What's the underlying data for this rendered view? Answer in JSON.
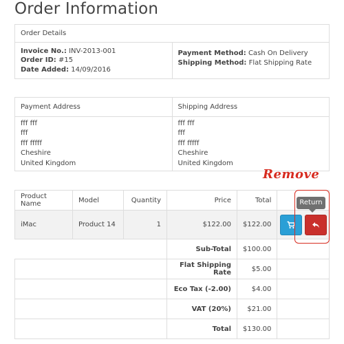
{
  "page_title": "Order Information",
  "order_details": {
    "header": "Order Details",
    "invoice_label": "Invoice No.:",
    "invoice_value": "INV-2013-001",
    "order_id_label": "Order ID:",
    "order_id_value": "#15",
    "date_label": "Date Added:",
    "date_value": "14/09/2016",
    "payment_method_label": "Payment Method:",
    "payment_method_value": "Cash On Delivery",
    "shipping_method_label": "Shipping Method:",
    "shipping_method_value": "Flat Shipping Rate"
  },
  "addresses": {
    "payment_header": "Payment Address",
    "shipping_header": "Shipping Address",
    "payment_lines": [
      "fff fff",
      "fff",
      "fff fffff",
      "Cheshire",
      "United Kingdom"
    ],
    "shipping_lines": [
      "fff fff",
      "fff",
      "fff fffff",
      "Cheshire",
      "United Kingdom"
    ]
  },
  "products": {
    "headers": {
      "name": "Product Name",
      "model": "Model",
      "quantity": "Quantity",
      "price": "Price",
      "total": "Total"
    },
    "rows": [
      {
        "name": "iMac",
        "model": "Product 14",
        "quantity": "1",
        "price": "$122.00",
        "total": "$122.00"
      }
    ],
    "totals": [
      {
        "label": "Sub-Total",
        "value": "$100.00"
      },
      {
        "label": "Flat Shipping Rate",
        "value": "$5.00"
      },
      {
        "label": "Eco Tax (-2.00)",
        "value": "$4.00"
      },
      {
        "label": "VAT (20%)",
        "value": "$21.00"
      },
      {
        "label": "Total",
        "value": "$130.00"
      }
    ]
  },
  "actions": {
    "reorder_icon": "shopping-cart-icon",
    "return_icon": "reply-icon",
    "return_tooltip": "Return"
  },
  "annotation": {
    "text": "Remove",
    "color": "#d72b1f"
  },
  "colors": {
    "cart_button": "#2a9fd6",
    "return_button": "#c9302c",
    "tooltip": "#707070"
  }
}
